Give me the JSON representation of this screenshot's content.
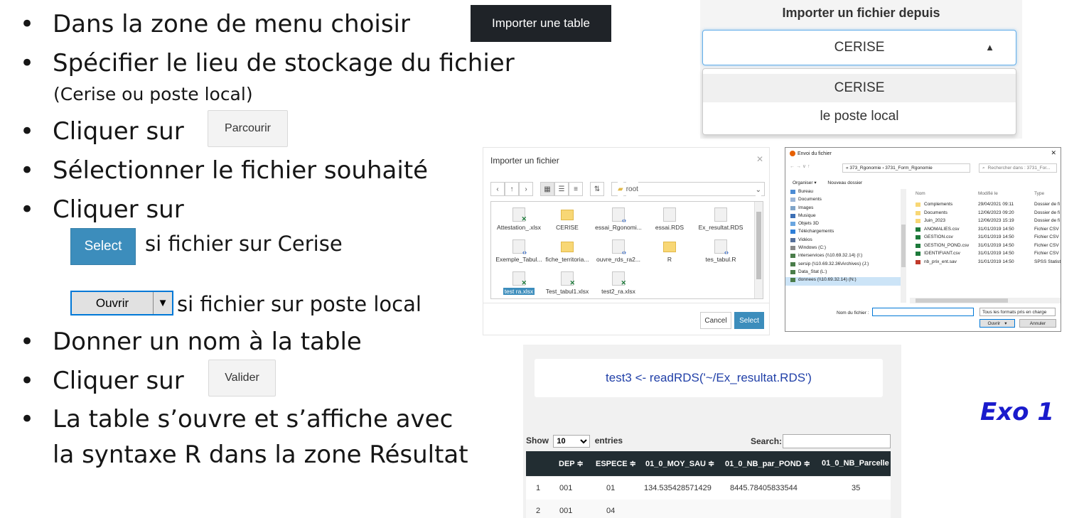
{
  "bullets": {
    "b1": "Dans la zone de menu choisir",
    "b2": "Spécifier le lieu de stockage du fichier",
    "b2_sub": "(Cerise ou poste local)",
    "b3": "Cliquer sur",
    "b4": "Sélectionner le fichier souhaité",
    "b5": "Cliquer sur",
    "b5_cerise": "si fichier sur Cerise",
    "b5_local": "si fichier sur poste local",
    "b6": "Donner un nom à la table",
    "b7": "Cliquer sur",
    "b8_line1": "La table s’ouvre et s’affiche avec",
    "b8_line2": "la syntaxe R dans la zone Résultat"
  },
  "buttons": {
    "importer_table": "Importer une table",
    "parcourir": "Parcourir",
    "select": "Select",
    "ouvrir": "Ouvrir",
    "valider": "Valider"
  },
  "import_from": {
    "title": "Importer un fichier depuis",
    "selected": "CERISE",
    "options": [
      "CERISE",
      "le poste local"
    ]
  },
  "file_dialog": {
    "title": "Importer un fichier",
    "path": "root",
    "files": [
      {
        "name": "Attestation_.xlsx",
        "type": "xl"
      },
      {
        "name": "CERISE",
        "type": "fol"
      },
      {
        "name": "essai_Rgonomi...",
        "type": "rd"
      },
      {
        "name": "essai.RDS",
        "type": "doc"
      },
      {
        "name": "Ex_resultat.RDS",
        "type": "doc"
      },
      {
        "name": "Exemple_Tabul...",
        "type": "rd"
      },
      {
        "name": "fiche_territoria...",
        "type": "fol"
      },
      {
        "name": "ouvre_rds_ra2...",
        "type": "rd"
      },
      {
        "name": "R",
        "type": "fol"
      },
      {
        "name": "tes_tabul.R",
        "type": "rd"
      },
      {
        "name": "test ra.xlsx",
        "type": "xl"
      },
      {
        "name": "Test_tabul1.xlsx",
        "type": "xl"
      },
      {
        "name": "test2_ra.xlsx",
        "type": "xl"
      }
    ],
    "cancel": "Cancel",
    "select": "Select"
  },
  "win_dialog": {
    "title": "Envoi du fichier",
    "address": "« 373_Rgonomie › 3731_Form_Rgonomie",
    "search": "Rechercher dans : 3731_For...",
    "organiser": "Organiser ▾",
    "nouveau": "Nouveau dossier",
    "nav": [
      "Bureau",
      "Documents",
      "Images",
      "Musique",
      "Objets 3D",
      "Téléchargements",
      "Vidéos",
      "Windows (C:)",
      "interservices (\\\\10.69.32.14) (I:)",
      "sersip (\\\\10.69.32.36\\Archives) (J:)",
      "Data_Stat (L:)",
      "donnees (\\\\10.69.32.14) (N:)"
    ],
    "col_nom": "Nom",
    "col_mod": "Modifié le",
    "col_type": "Type",
    "rows": [
      {
        "name": "Complements",
        "date": "29/04/2021 09:11",
        "type": "Dossier de fi",
        "kind": "fol"
      },
      {
        "name": "Documents",
        "date": "12/06/2023 09:20",
        "type": "Dossier de fi",
        "kind": "fol"
      },
      {
        "name": "Juin_2023",
        "date": "12/06/2023 15:19",
        "type": "Dossier de fi",
        "kind": "fol"
      },
      {
        "name": "ANOMALIES.csv",
        "date": "31/01/2019 14:50",
        "type": "Fichier CSV M",
        "kind": "csv"
      },
      {
        "name": "GESTION.csv",
        "date": "31/01/2019 14:50",
        "type": "Fichier CSV M",
        "kind": "csv"
      },
      {
        "name": "GESTION_POND.csv",
        "date": "31/01/2019 14:50",
        "type": "Fichier CSV M",
        "kind": "csv"
      },
      {
        "name": "IDENTIFIANT.csv",
        "date": "31/01/2019 14:50",
        "type": "Fichier CSV M",
        "kind": "csv"
      },
      {
        "name": "nb_prix_ent.sav",
        "date": "31/01/2019 14:50",
        "type": "SPSS Statistic",
        "kind": "sav"
      }
    ],
    "nom_fichier": "Nom du fichier :",
    "format": "Tous les formats pris en charge",
    "ouvrir": "Ouvrir",
    "annuler": "Annuler"
  },
  "result": {
    "code": "test3 <- readRDS('~/Ex_resultat.RDS')",
    "show": "Show",
    "entries_value": "10",
    "entries": "entries",
    "search": "Search:",
    "headers": [
      "DEP ≑",
      "ESPECE ≑",
      "01_0_MOY_SAU ≑",
      "01_0_NB_par_POND ≑",
      "01_0_NB_Parcelle"
    ],
    "rows": [
      [
        "1",
        "001",
        "01",
        "134.535428571429",
        "8445.78405833544",
        "35"
      ],
      [
        "2",
        "001",
        "04",
        "",
        "",
        ""
      ]
    ]
  },
  "exo": "Exo 1"
}
